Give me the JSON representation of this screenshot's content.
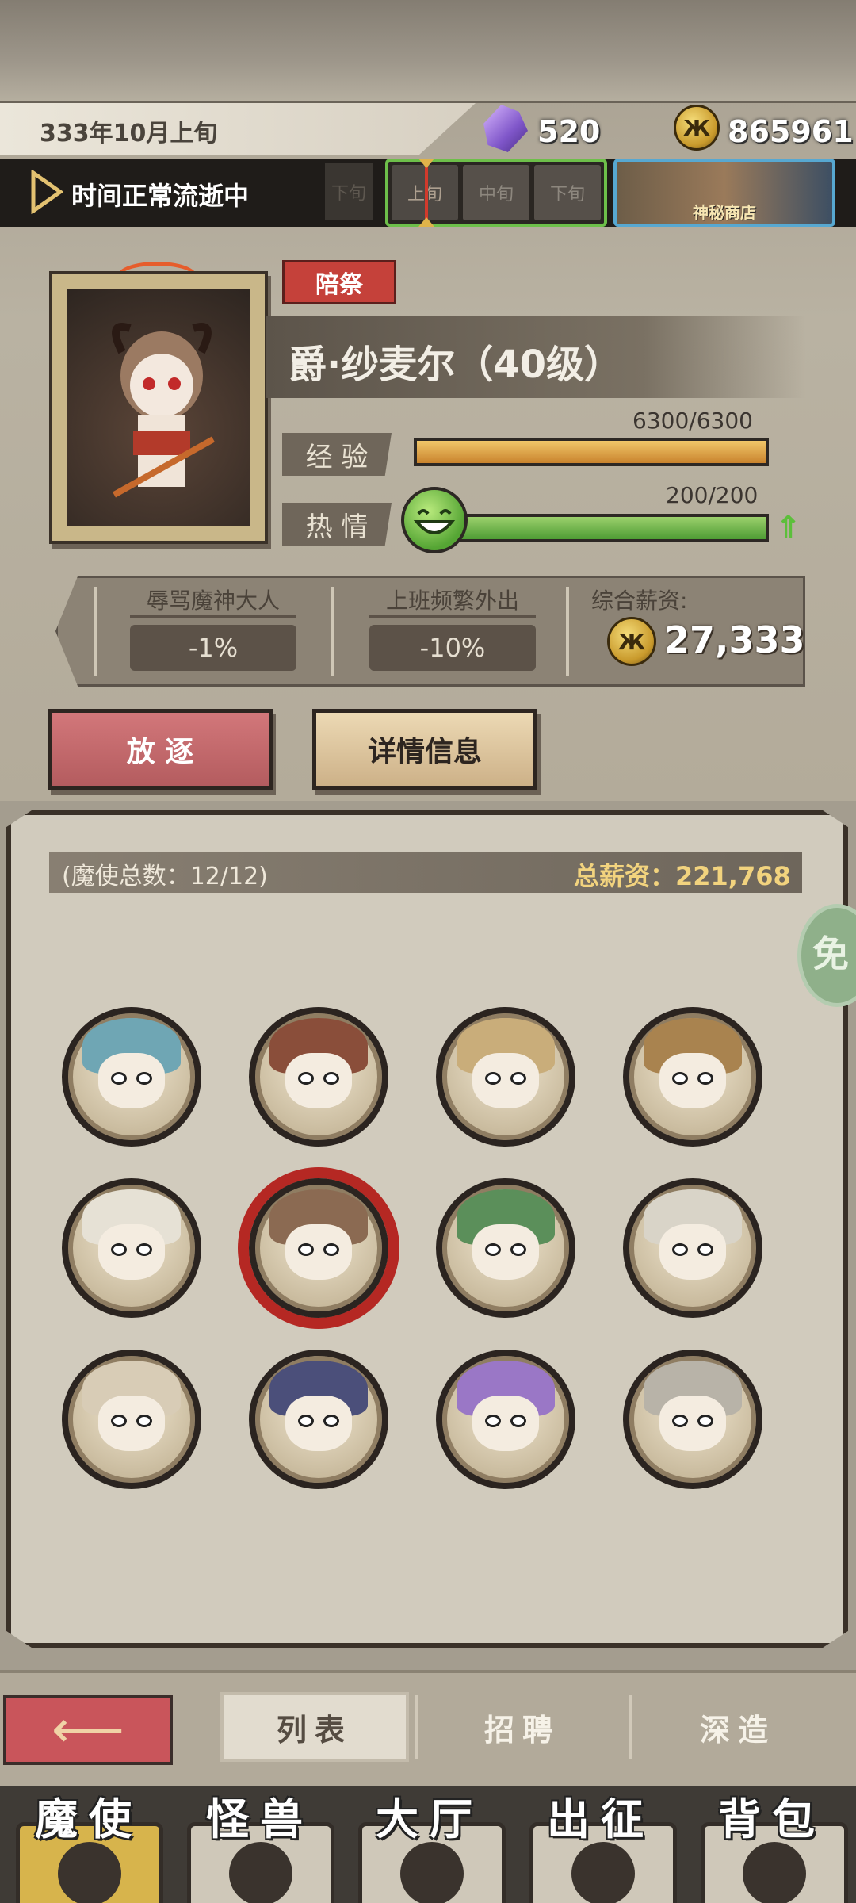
{
  "status": {
    "date": "333年10月上旬",
    "gems": "520",
    "coins": "865961",
    "time_status": "时间正常流逝中",
    "periods": [
      "下旬",
      "上旬",
      "中旬",
      "下旬"
    ],
    "shop_label": "神秘商店"
  },
  "character": {
    "role": "陪祭",
    "name": "爵·纱麦尔（40级）",
    "exp_label": "经 验",
    "exp_value": "6300/6300",
    "exp_progress": 1.0,
    "passion_label": "热 情",
    "passion_value": "200/200",
    "passion_progress": 1.0,
    "traits": [
      {
        "title": "辱骂魔神大人",
        "value": "-1%"
      },
      {
        "title": "上班频繁外出",
        "value": "-10%"
      }
    ],
    "salary_title": "综合薪资:",
    "salary_value": "27,333"
  },
  "actions": {
    "exile": "放 逐",
    "details": "详情信息"
  },
  "roster": {
    "count_text": "(魔使总数：12/12)",
    "total_salary": "总薪资：221,768",
    "free_badge": "免",
    "selected_index": 5,
    "avatars": [
      {
        "name": "avatar-blue-horned",
        "hair": "#6fa6b4"
      },
      {
        "name": "avatar-masked-brute",
        "hair": "#8a4e3a"
      },
      {
        "name": "avatar-purple-horned",
        "hair": "#c9ad7a"
      },
      {
        "name": "avatar-witch-hat",
        "hair": "#a9834f"
      },
      {
        "name": "avatar-skull-helm",
        "hair": "#e6e1d5"
      },
      {
        "name": "avatar-demon-girl",
        "hair": "#8b6a52"
      },
      {
        "name": "avatar-frog-hood",
        "hair": "#5b8f5a"
      },
      {
        "name": "avatar-blue-masked",
        "hair": "#d9d4c8"
      },
      {
        "name": "avatar-hooded-red-horn",
        "hair": "#d8ccb6"
      },
      {
        "name": "avatar-top-hat",
        "hair": "#4b4f7a"
      },
      {
        "name": "avatar-purple-hood",
        "hair": "#9a77c6"
      },
      {
        "name": "avatar-red-beast",
        "hair": "#b8b3a8"
      }
    ]
  },
  "subnav": {
    "tabs": [
      "列表",
      "招聘",
      "深造"
    ],
    "active": 0
  },
  "mainnav": {
    "tabs": [
      "魔使",
      "怪兽",
      "大厅",
      "出征",
      "背包"
    ],
    "active": 0
  }
}
